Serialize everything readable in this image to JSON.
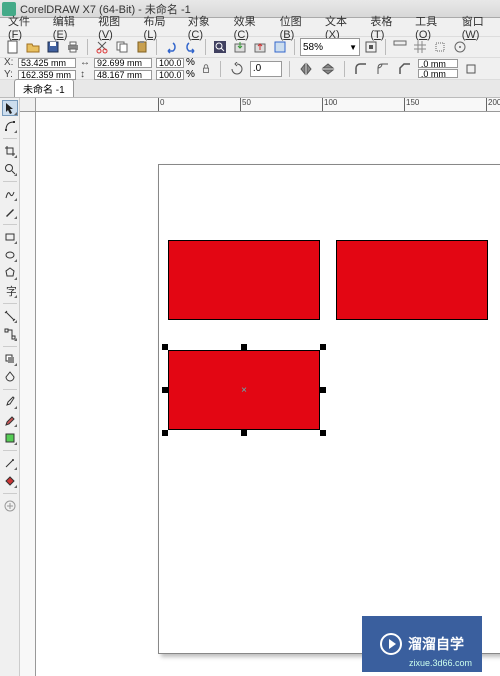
{
  "titlebar": {
    "title": "CorelDRAW X7 (64-Bit) - 未命名 -1"
  },
  "menubar": [
    {
      "label": "文件",
      "key": "F"
    },
    {
      "label": "编辑",
      "key": "E"
    },
    {
      "label": "视图",
      "key": "V"
    },
    {
      "label": "布局",
      "key": "L"
    },
    {
      "label": "对象",
      "key": "C"
    },
    {
      "label": "效果",
      "key": "C"
    },
    {
      "label": "位图",
      "key": "B"
    },
    {
      "label": "文本",
      "key": "X"
    },
    {
      "label": "表格",
      "key": "T"
    },
    {
      "label": "工具",
      "key": "O"
    },
    {
      "label": "窗口",
      "key": "W"
    }
  ],
  "toolbar1": {
    "zoom": "58%"
  },
  "propbar": {
    "x": "53.425 mm",
    "y": "162.359 mm",
    "w": "92.699 mm",
    "h": "48.167 mm",
    "scale_x": "100.0",
    "scale_y": "100.0",
    "pct": "%",
    "rotation": ".0",
    "outline_w1": ".0 mm",
    "outline_w2": ".0 mm"
  },
  "doctabs": {
    "tab1": "未命名 -1"
  },
  "ruler_h": {
    "ticks": [
      {
        "pos": 24,
        "label": "0"
      },
      {
        "pos": 106,
        "label": "50"
      },
      {
        "pos": 188,
        "label": "100"
      },
      {
        "pos": 270,
        "label": "150"
      },
      {
        "pos": 352,
        "label": "200"
      }
    ]
  },
  "watermark": {
    "brand": "溜溜自学",
    "url": "zixue.3d66.com"
  }
}
